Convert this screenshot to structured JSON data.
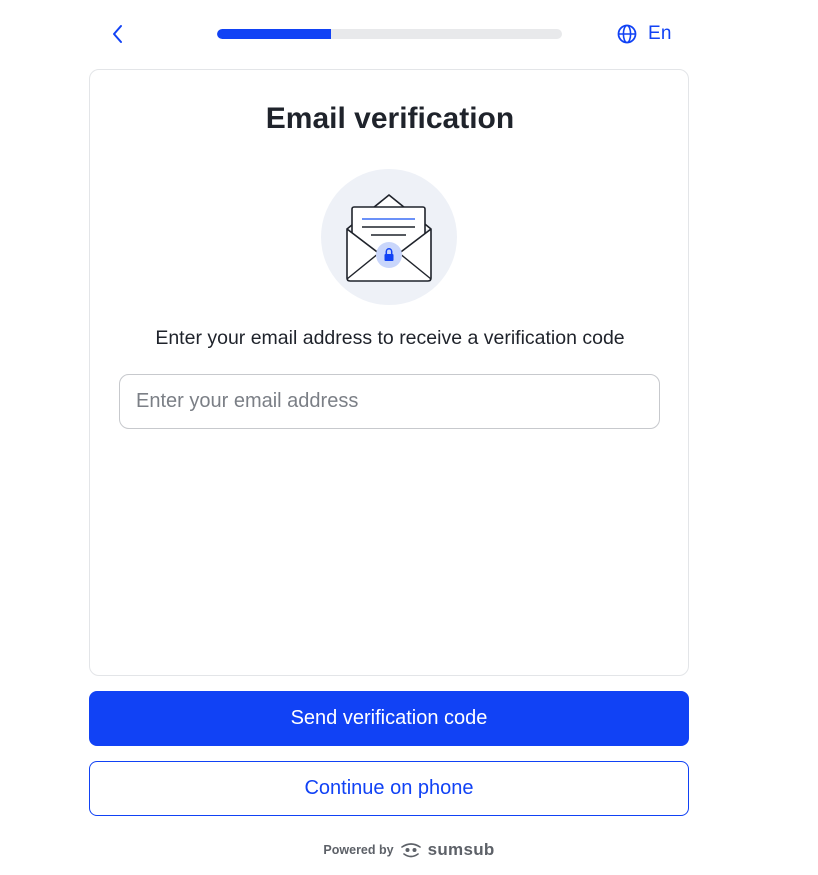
{
  "header": {
    "back_label": "",
    "progress_fraction": 0.33,
    "language_label": "En"
  },
  "card": {
    "title": "Email verification",
    "subtitle": "Enter your email address to receive a verification code",
    "email_input": {
      "value": "",
      "placeholder": "Enter your email address"
    },
    "illustration_icon": "envelope-lock-icon"
  },
  "actions": {
    "primary_label": "Send verification code",
    "secondary_label": "Continue on phone"
  },
  "footer": {
    "powered_by": "Powered by",
    "brand": "sumsub"
  },
  "colors": {
    "accent": "#1142f5",
    "text": "#1f232b",
    "muted": "#7b7f86"
  }
}
